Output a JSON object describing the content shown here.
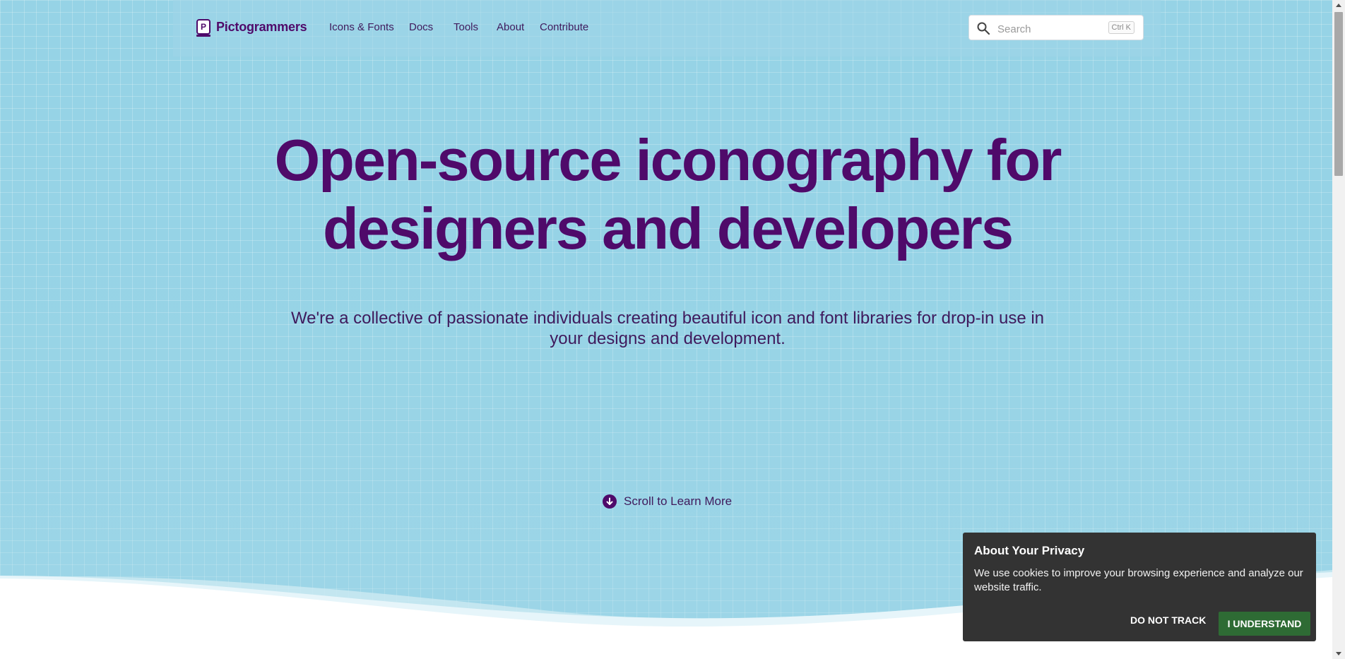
{
  "header": {
    "brand": "Pictogrammers",
    "nav": [
      {
        "label": "Icons & Fonts"
      },
      {
        "label": "Docs"
      },
      {
        "label": "Tools"
      },
      {
        "label": "About"
      },
      {
        "label": "Contribute"
      }
    ],
    "search": {
      "placeholder": "Search",
      "shortcut": "Ctrl K"
    }
  },
  "hero": {
    "title_line1": "Open-source iconography for",
    "title_line2": "designers and developers",
    "subtitle": "We're a collective of passionate individuals creating beautiful icon and font libraries for drop-in use in your designs and development.",
    "scroll_cta": "Scroll to Learn More"
  },
  "privacy_banner": {
    "title": "About Your Privacy",
    "text": "We use cookies to improve your browsing experience and analyze our website traffic.",
    "do_not_track": "DO NOT TRACK",
    "accept": "I UNDERSTAND"
  },
  "colors": {
    "brand_purple": "#4f0a6a",
    "hero_bg": "#96d3e6",
    "accept_green": "#2e6b34",
    "banner_bg": "#333333"
  }
}
